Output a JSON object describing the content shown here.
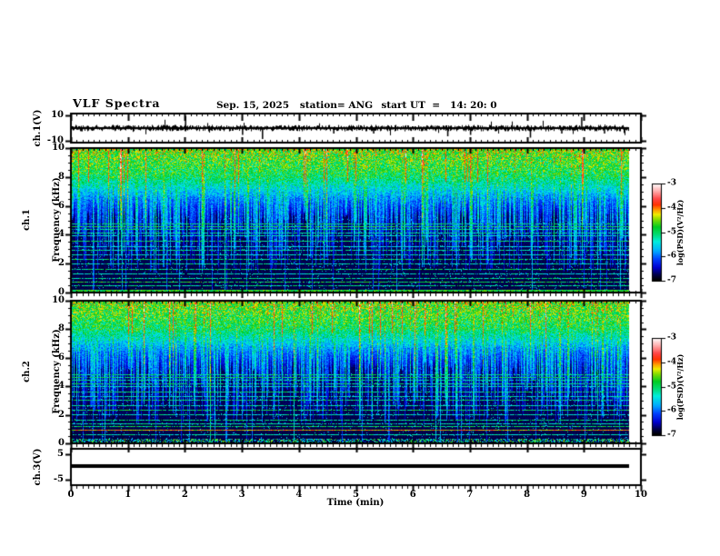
{
  "header": {
    "title": "VLF Spectra",
    "date": "Sep. 15, 2025",
    "station": "station= ANG",
    "start_ut": "start UT  =   14: 20: 0"
  },
  "axes": {
    "time_label": "Time (min)",
    "time_ticks": [
      "0",
      "1",
      "2",
      "3",
      "4",
      "5",
      "6",
      "7",
      "8",
      "9",
      "10"
    ],
    "time_range_min": [
      0,
      10
    ],
    "freq_ticks": [
      "0",
      "2",
      "4",
      "6",
      "8",
      "10"
    ],
    "freq_range_khz": [
      0,
      10
    ]
  },
  "panels": {
    "ch1_wave": {
      "ylabel": "ch.1(V)",
      "ytick_top": "10",
      "ytick_bottom": "-10",
      "ylim_v": [
        -10,
        10
      ]
    },
    "spec1": {
      "ylabel_line1": "ch.1",
      "ylabel_line2": "Frequency (kHz)"
    },
    "spec2": {
      "ylabel_line1": "ch.2",
      "ylabel_line2": "Frequency (kHz)"
    },
    "ch3": {
      "ylabel": "ch.3(V)",
      "ytick_top": "5",
      "ytick_bottom": "-5",
      "ylim_v": [
        -5,
        5
      ]
    }
  },
  "colorbar": {
    "label": "log(PSD)(V²/Hz)",
    "ticks": [
      "-3",
      "-4",
      "-5",
      "-6",
      "-7"
    ],
    "range_log10": [
      -7,
      -3
    ],
    "gradient_stops": [
      0,
      0.05,
      0.13,
      0.22,
      0.3,
      0.4,
      0.47,
      0.55,
      0.63,
      0.68,
      0.73,
      0.78,
      0.84,
      0.92,
      1.0
    ],
    "gradient_bottom_to_top": [
      "#000000",
      "#000040",
      "#0000d0",
      "#0044ff",
      "#00aaff",
      "#00eedd",
      "#00dd77",
      "#00cc22",
      "#88dd00",
      "#eeee00",
      "#ff9900",
      "#ff3300",
      "#ff4444",
      "#ffaaaa",
      "#ffffff"
    ]
  },
  "chart_data": [
    {
      "type": "line",
      "name": "ch1-voltage-trace",
      "ylabel": "ch.1(V)",
      "ylim_v": [
        -10,
        10
      ],
      "x_range_min": [
        0,
        9.8
      ],
      "baseline_v": 0,
      "noise_pp_v": 2,
      "spikes": [
        {
          "t_min": 2.0,
          "v": 9
        },
        {
          "t_min": 3.0,
          "v": -5
        },
        {
          "t_min": 3.35,
          "v": -8
        },
        {
          "t_min": 4.6,
          "v": -4
        },
        {
          "t_min": 5.3,
          "v": -4
        },
        {
          "t_min": 6.6,
          "v": -6
        },
        {
          "t_min": 7.0,
          "v": -5
        },
        {
          "t_min": 8.05,
          "v": -7
        },
        {
          "t_min": 8.6,
          "v": -4
        },
        {
          "t_min": 8.95,
          "v": 8
        },
        {
          "t_min": 9.35,
          "v": -4
        }
      ]
    },
    {
      "type": "heatmap",
      "name": "ch1-spectrogram",
      "x_range_min": [
        0,
        9.8
      ],
      "y_range_khz": [
        0,
        10
      ],
      "value_label": "log(PSD)(V²/Hz)",
      "value_range_log10": [
        -7,
        -3
      ],
      "background_profile": [
        {
          "f_khz": 10,
          "psd": -4.55
        },
        {
          "f_khz": 8,
          "psd": -5.0
        },
        {
          "f_khz": 5.3,
          "psd": -6.72
        },
        {
          "f_khz": 0,
          "psd": -6.78
        }
      ],
      "streaks": "dense vertical sferic streaks strongest above 6 kHz, sporadic full-band events",
      "horizontal_lines": [
        {
          "f_khz": 4.75,
          "psd": -5.1
        },
        {
          "f_khz": 4.55,
          "psd": -4.95
        },
        {
          "f_khz": 4.35,
          "psd": -5.1
        },
        {
          "f_khz": 4.1,
          "psd": -5.2
        },
        {
          "f_khz": 3.9,
          "psd": -5.3
        },
        {
          "f_khz": 3.55,
          "psd": -5.0
        },
        {
          "f_khz": 3.2,
          "psd": -5.4
        },
        {
          "f_khz": 2.95,
          "psd": -5.15
        },
        {
          "f_khz": 2.6,
          "psd": -5.3
        },
        {
          "f_khz": 2.3,
          "psd": -5.05
        },
        {
          "f_khz": 1.95,
          "psd": -5.25
        },
        {
          "f_khz": 1.6,
          "psd": -5.05
        },
        {
          "f_khz": 1.3,
          "psd": -5.35
        },
        {
          "f_khz": 1.0,
          "psd": -5.15
        },
        {
          "f_khz": 0.7,
          "psd": -4.9
        },
        {
          "f_khz": 0.45,
          "psd": -5.2
        }
      ],
      "bottom_band": {
        "f_max_khz": 0.18,
        "psd": -4.9,
        "solid": true
      }
    },
    {
      "type": "heatmap",
      "name": "ch2-spectrogram",
      "x_range_min": [
        0,
        9.8
      ],
      "y_range_khz": [
        0,
        10
      ],
      "value_label": "log(PSD)(V²/Hz)",
      "value_range_log10": [
        -7,
        -3
      ],
      "background_profile": [
        {
          "f_khz": 10,
          "psd": -4.55
        },
        {
          "f_khz": 8,
          "psd": -5.0
        },
        {
          "f_khz": 5.3,
          "psd": -6.72
        },
        {
          "f_khz": 0,
          "psd": -6.78
        }
      ],
      "streaks": "dense vertical sferic streaks strongest above 6 kHz, sporadic full-band events",
      "horizontal_lines": [
        {
          "f_khz": 4.8,
          "psd": -5.1
        },
        {
          "f_khz": 4.6,
          "psd": -5.0
        },
        {
          "f_khz": 4.4,
          "psd": -5.2
        },
        {
          "f_khz": 4.15,
          "psd": -5.1
        },
        {
          "f_khz": 3.95,
          "psd": -5.3
        },
        {
          "f_khz": 3.6,
          "psd": -5.05
        },
        {
          "f_khz": 3.25,
          "psd": -5.3
        },
        {
          "f_khz": 3.0,
          "psd": -5.1
        },
        {
          "f_khz": 2.65,
          "psd": -5.25
        },
        {
          "f_khz": 2.35,
          "psd": -5.0
        },
        {
          "f_khz": 2.0,
          "psd": -5.3
        },
        {
          "f_khz": 1.65,
          "psd": -5.1
        },
        {
          "f_khz": 1.35,
          "psd": -5.25
        },
        {
          "f_khz": 1.15,
          "psd": -5.0
        },
        {
          "f_khz": 0.95,
          "psd": -4.15,
          "solid": true
        },
        {
          "f_khz": 0.6,
          "psd": -5.3
        }
      ],
      "bottom_band": {
        "f_max_khz": 0.3,
        "psd": -5.1,
        "solid": false
      }
    },
    {
      "type": "line",
      "name": "ch3-voltage-trace",
      "ylabel": "ch.3(V)",
      "ylim_v": [
        -5,
        5
      ],
      "x_range_min": [
        0,
        9.8
      ],
      "constant_v": 0
    }
  ]
}
